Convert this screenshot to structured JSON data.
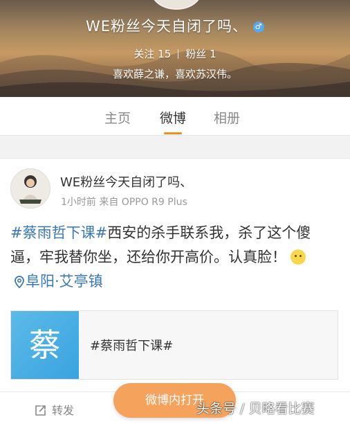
{
  "profile": {
    "name": "WE粉丝今天自闭了吗、",
    "gender_icon": "male-icon",
    "following_label": "关注",
    "following_count": "15",
    "followers_label": "粉丝",
    "followers_count": "1",
    "bio": "喜欢薛之谦，喜欢苏汉伟。"
  },
  "tabs": [
    {
      "label": "主页"
    },
    {
      "label": "微博",
      "active": true
    },
    {
      "label": "相册"
    }
  ],
  "post": {
    "author": "WE粉丝今天自闭了吗、",
    "meta": "1小时前 来自 OPPO R9 Plus",
    "topic": "#蔡雨哲下课#",
    "text_1": "西安的杀手联系我，杀了这个傻逼，牢我替你坐，还给你开高价。认真脸！",
    "emoji": "smile-emoji-icon",
    "location": "阜阳·艾亭镇",
    "link_card": {
      "thumb_text": "蔡",
      "title": "#蔡雨哲下课#"
    }
  },
  "actions": {
    "repost_label": "转发",
    "open_button": "微博内打开"
  },
  "watermark": "头条号 / 贝略看比赛",
  "colors": {
    "accent_orange": "#f28d1e",
    "link_blue": "#3a77b8",
    "button_orange": "#f5a25d",
    "thumb_blue": "#4fb2e5"
  }
}
